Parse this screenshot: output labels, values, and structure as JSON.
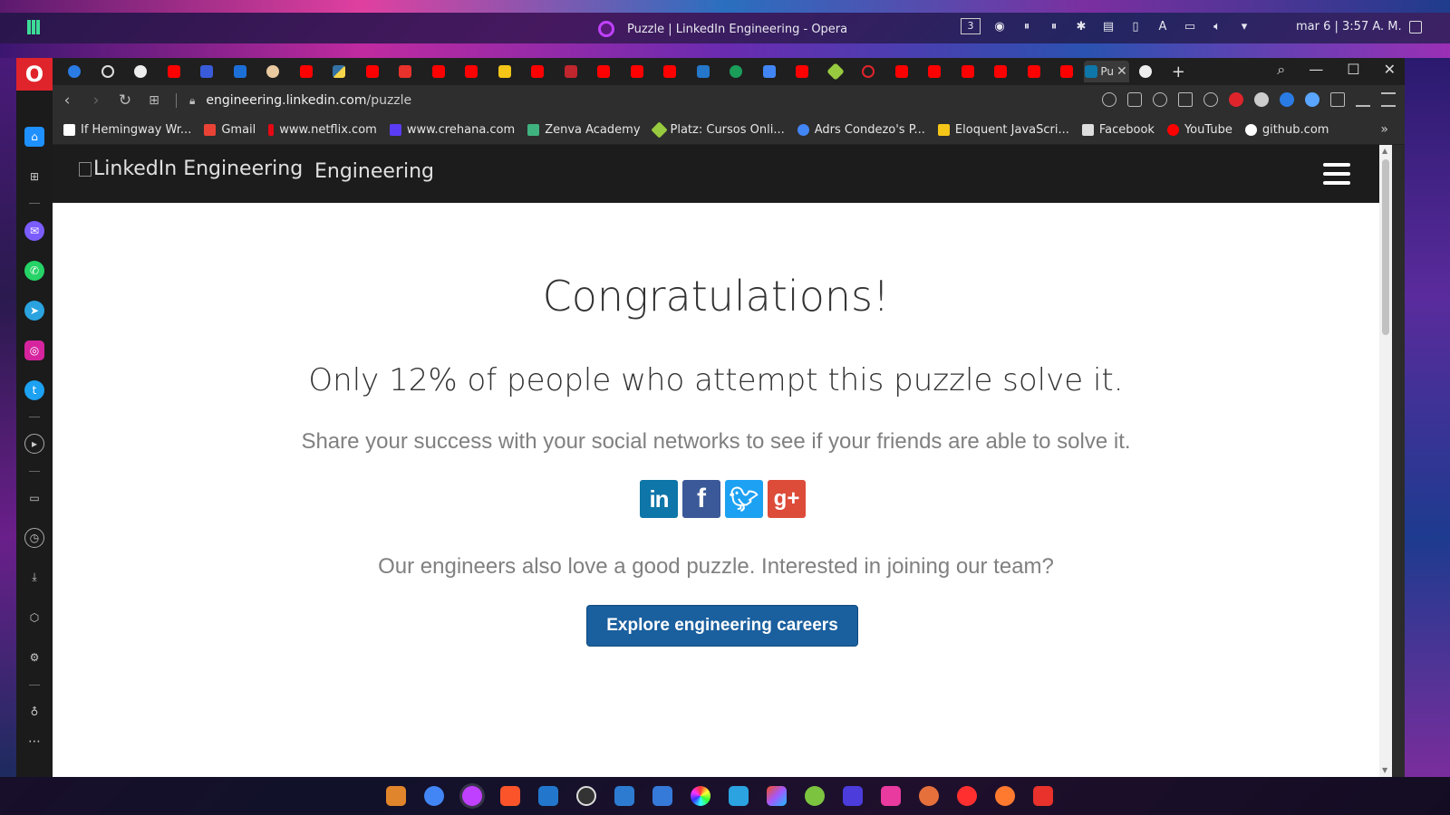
{
  "system_panel": {
    "window_title": "Puzzle | LinkedIn Engineering - Opera",
    "workspace_number": "3",
    "clock": "mar 6 | 3:57 A. M."
  },
  "browser": {
    "active_tab_label": "Pu",
    "url_host": "engineering.linkedin.com",
    "url_path": "/puzzle",
    "bookmarks": [
      {
        "label": "If Hemingway Wr...",
        "color": "#222"
      },
      {
        "label": "Gmail",
        "color": "#ea4335"
      },
      {
        "label": "www.netflix.com",
        "color": "#e50914"
      },
      {
        "label": "www.crehana.com",
        "color": "#5b3cf5"
      },
      {
        "label": "Zenva Academy",
        "color": "#3fb27f"
      },
      {
        "label": "Platz: Cursos Onli...",
        "color": "#98ca3f"
      },
      {
        "label": "Adrs Condezo's P...",
        "color": "#4285f4"
      },
      {
        "label": "Eloquent JavaScri...",
        "color": "#f5c518"
      },
      {
        "label": "Facebook",
        "color": "#dddddd"
      },
      {
        "label": "YouTube",
        "color": "#ff0000"
      },
      {
        "label": "github.com",
        "color": "#ffffff"
      }
    ]
  },
  "site": {
    "logo_alt": "LinkedIn Engineering",
    "logo_sub": "Engineering"
  },
  "puzzle": {
    "heading": "Congratulations!",
    "subheading": "Only 12% of people who attempt this puzzle solve it.",
    "share_text": "Share your success with your social networks to see if your friends are able to solve it.",
    "social": [
      {
        "name": "linkedin",
        "glyph": "in",
        "color": "#0e76a8"
      },
      {
        "name": "facebook",
        "glyph": "f",
        "color": "#3b5998"
      },
      {
        "name": "twitter",
        "glyph": "t",
        "color": "#1da1f2"
      },
      {
        "name": "googleplus",
        "glyph": "g+",
        "color": "#dd4b39"
      }
    ],
    "join_text": "Our engineers also love a good puzzle. Interested in joining our team?",
    "cta_label": "Explore engineering careers"
  },
  "colors": {
    "header_bg": "#1c1c1c",
    "cta_bg": "#1a5f9e",
    "opera_red": "#e0242b"
  }
}
